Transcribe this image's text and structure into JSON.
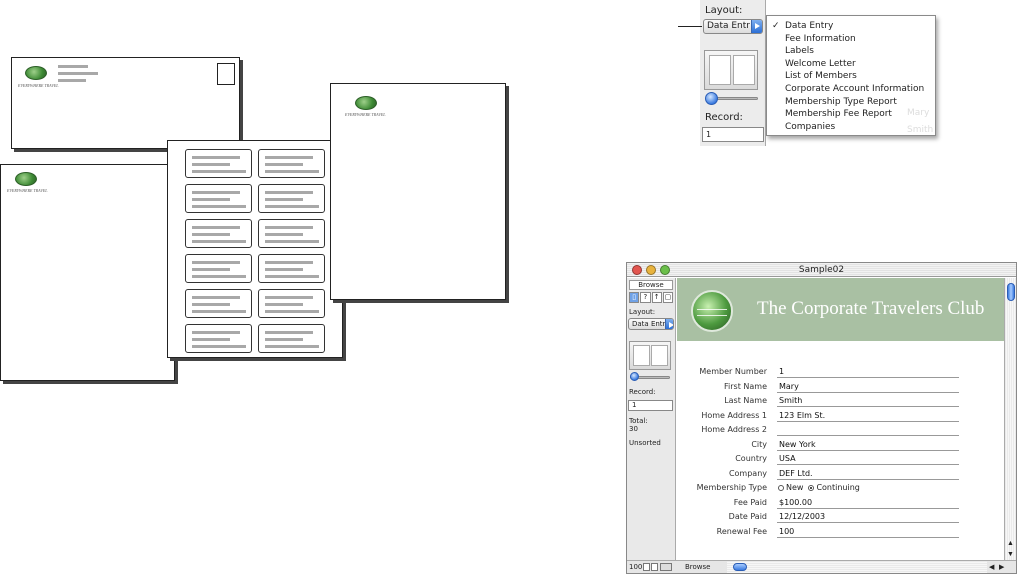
{
  "illustrations": {
    "logo_text": "EVERYWHERE TRAVEL"
  },
  "callout": {
    "layout_label": "Layout:",
    "layout_value": "Data Entr",
    "record_label": "Record:",
    "record_value": "1",
    "behind_values": [
      "Mary",
      "Smith"
    ],
    "menu_items": [
      {
        "label": "Data Entry",
        "checked": true
      },
      {
        "label": "Fee Information",
        "checked": false
      },
      {
        "label": "Labels",
        "checked": false
      },
      {
        "label": "Welcome Letter",
        "checked": false
      },
      {
        "label": "List of Members",
        "checked": false
      },
      {
        "label": "Corporate Account Information",
        "checked": false
      },
      {
        "label": "Membership Type Report",
        "checked": false
      },
      {
        "label": "Membership Fee Report",
        "checked": false
      },
      {
        "label": "Companies",
        "checked": false
      }
    ],
    "check_glyph": "✓"
  },
  "window": {
    "title": "Sample02",
    "traffic_colors": {
      "close": "#e2554f",
      "minimize": "#e8b33e",
      "zoom": "#6bbf4a"
    },
    "status": {
      "mode_tab": "Browse",
      "layout_label": "Layout:",
      "layout_value": "Data Entr",
      "record_label": "Record:",
      "record_value": "1",
      "total_label": "Total:",
      "total_value": "30",
      "sort_state": "Unsorted"
    },
    "banner": {
      "title": "The Corporate Travelers Club",
      "color": "#a9c0a3"
    },
    "fields": [
      {
        "label": "Member Number",
        "value": "1"
      },
      {
        "label": "First Name",
        "value": "Mary"
      },
      {
        "label": "Last Name",
        "value": "Smith"
      },
      {
        "label": "Home Address 1",
        "value": "123 Elm St."
      },
      {
        "label": "Home Address 2",
        "value": ""
      },
      {
        "label": "City",
        "value": "New York"
      },
      {
        "label": "Country",
        "value": "USA"
      },
      {
        "label": "Company",
        "value": "DEF Ltd."
      }
    ],
    "membership_type": {
      "label": "Membership Type",
      "options": [
        "New",
        "Continuing"
      ],
      "selected": "Continuing"
    },
    "fields2": [
      {
        "label": "Fee Paid",
        "value": "$100.00"
      },
      {
        "label": "Date Paid",
        "value": "12/12/2003"
      },
      {
        "label": "Renewal Fee",
        "value": "100"
      }
    ],
    "bottom": {
      "zoom": "100",
      "mode": "Browse"
    }
  }
}
